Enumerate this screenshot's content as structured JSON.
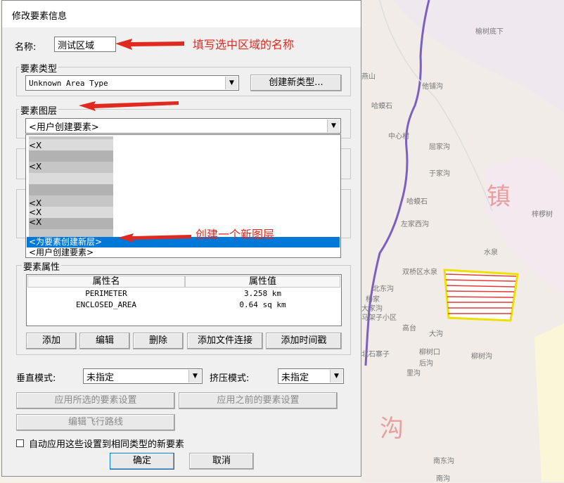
{
  "dialog": {
    "title": "修改要素信息",
    "name_label": "名称:",
    "name_value": "测试区域",
    "type_group": "要素类型",
    "type_value": "Unknown Area Type",
    "create_type_button": "创建新类型...",
    "layer_group": "要素图层",
    "layer_value": "<用户创建要素>",
    "layer_options": [
      "<X",
      "<X",
      "<X",
      "<X",
      "<X"
    ],
    "layer_option_selected": "<为要素创建新层>",
    "layer_option_last": "<用户创建要素>",
    "attr_group": "要素属性",
    "attr_columns": [
      "属性名",
      "属性值"
    ],
    "attr_rows": [
      {
        "name": "PERIMETER",
        "value": "3.258 km"
      },
      {
        "name": "ENCLOSED_AREA",
        "value": "0.64 sq km"
      }
    ],
    "attr_buttons": [
      "添加",
      "编辑",
      "删除",
      "添加文件连接",
      "添加时间戳"
    ],
    "vertical_mode_label": "垂直模式:",
    "vertical_mode_value": "未指定",
    "extrude_mode_label": "挤压模式:",
    "extrude_mode_value": "未指定",
    "apply_selected_button": "应用所选的要素设置",
    "apply_previous_button": "应用之前的要素设置",
    "edit_flight_button": "编辑飞行路线",
    "auto_apply_label": "自动应用这些设置到相同类型的新要素",
    "ok_button": "确定",
    "cancel_button": "取消"
  },
  "annotations": {
    "name_hint": "填写选中区域的名称",
    "new_layer_hint": "创建一个新图层"
  },
  "map": {
    "labels": [
      "榆树底下",
      "燕山",
      "他铺沟",
      "哈蟆石",
      "中心村",
      "屈家沟",
      "于家沟",
      "哈蟆石",
      "左家西沟",
      "水泉",
      "双桥区水泉",
      "北东沟",
      "杨家",
      "大家沟",
      "马架子小区",
      "高台",
      "大沟",
      "北石寨子",
      "柳树口",
      "后沟",
      "里沟",
      "柳树沟",
      "南东沟",
      "南沟",
      "梓椤树"
    ],
    "big_labels": [
      "镇",
      "沟"
    ],
    "region_color": "#ffee00"
  }
}
